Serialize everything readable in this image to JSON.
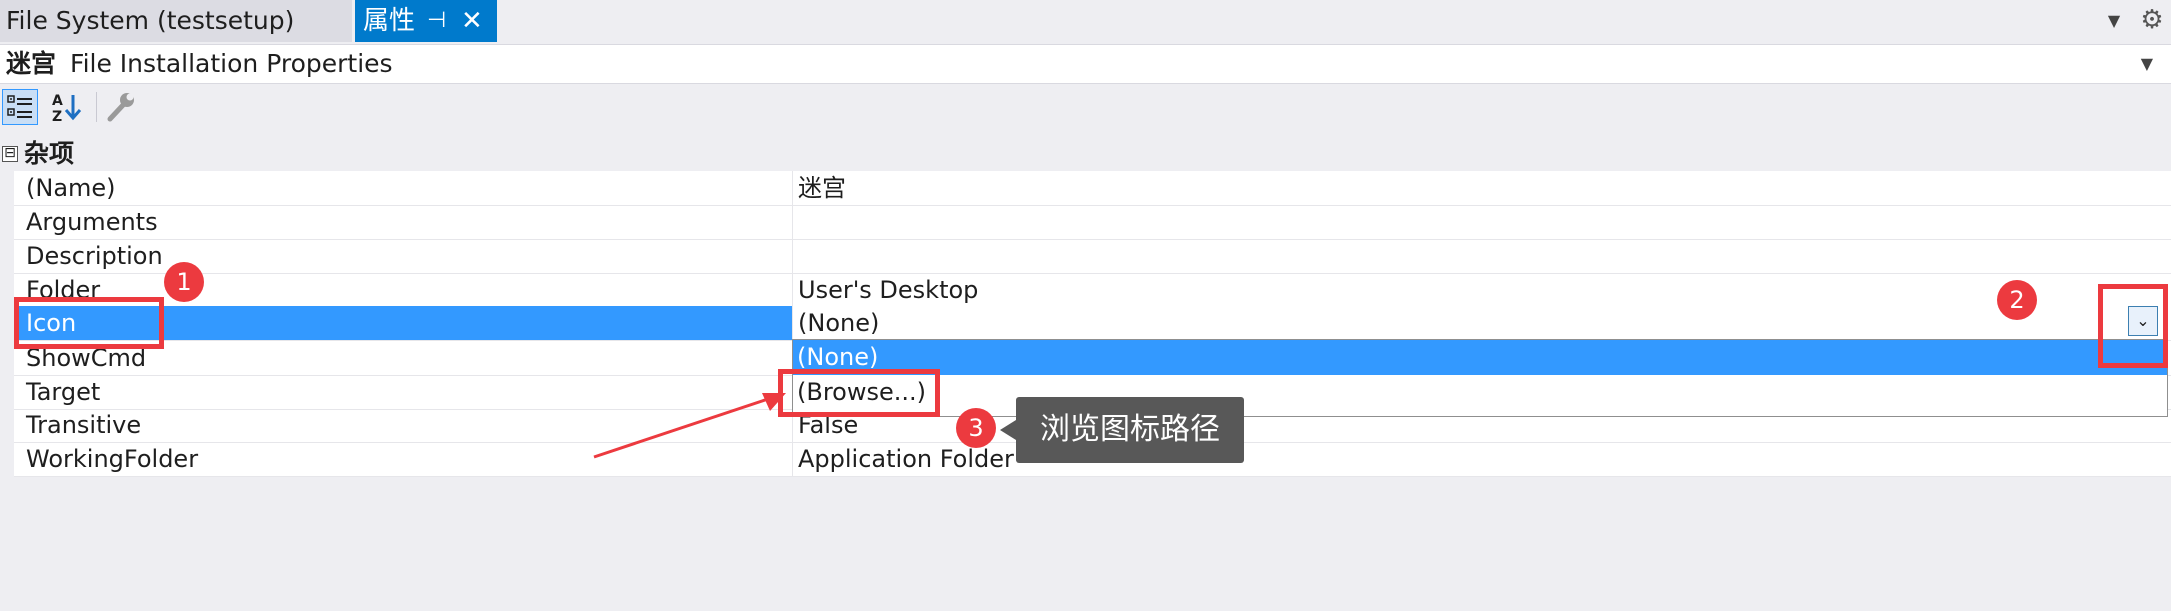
{
  "tabs": {
    "file_system": "File System (testsetup)",
    "properties": "属性",
    "pin_glyph": "⊣",
    "close_glyph": "✕"
  },
  "object_selector": {
    "object_name": "迷宫",
    "object_type": "File Installation Properties"
  },
  "toolbar": {
    "categorized": "categorized-icon",
    "alphabetical": "sort-az-icon",
    "property_pages": "wrench-icon"
  },
  "section": {
    "title": "杂项",
    "toggle": "⊟"
  },
  "properties": [
    {
      "name": "(Name)",
      "value": "迷宫"
    },
    {
      "name": "Arguments",
      "value": ""
    },
    {
      "name": "Description",
      "value": ""
    },
    {
      "name": "Folder",
      "value": "User's Desktop"
    },
    {
      "name": "Icon",
      "value": "(None)"
    },
    {
      "name": "ShowCmd",
      "value": ""
    },
    {
      "name": "Target",
      "value": ""
    },
    {
      "name": "Transitive",
      "value": "False"
    },
    {
      "name": "WorkingFolder",
      "value": "Application Folder"
    }
  ],
  "dropdown": {
    "options": [
      "(None)",
      "(Browse...)"
    ],
    "selected": "(None)"
  },
  "annotations": {
    "badge1": "1",
    "badge2": "2",
    "badge3": "3",
    "tooltip": "浏览图标路径"
  },
  "colors": {
    "accent": "#007acc",
    "selection": "#3399ff",
    "annotation_red": "#ec3a3f"
  }
}
